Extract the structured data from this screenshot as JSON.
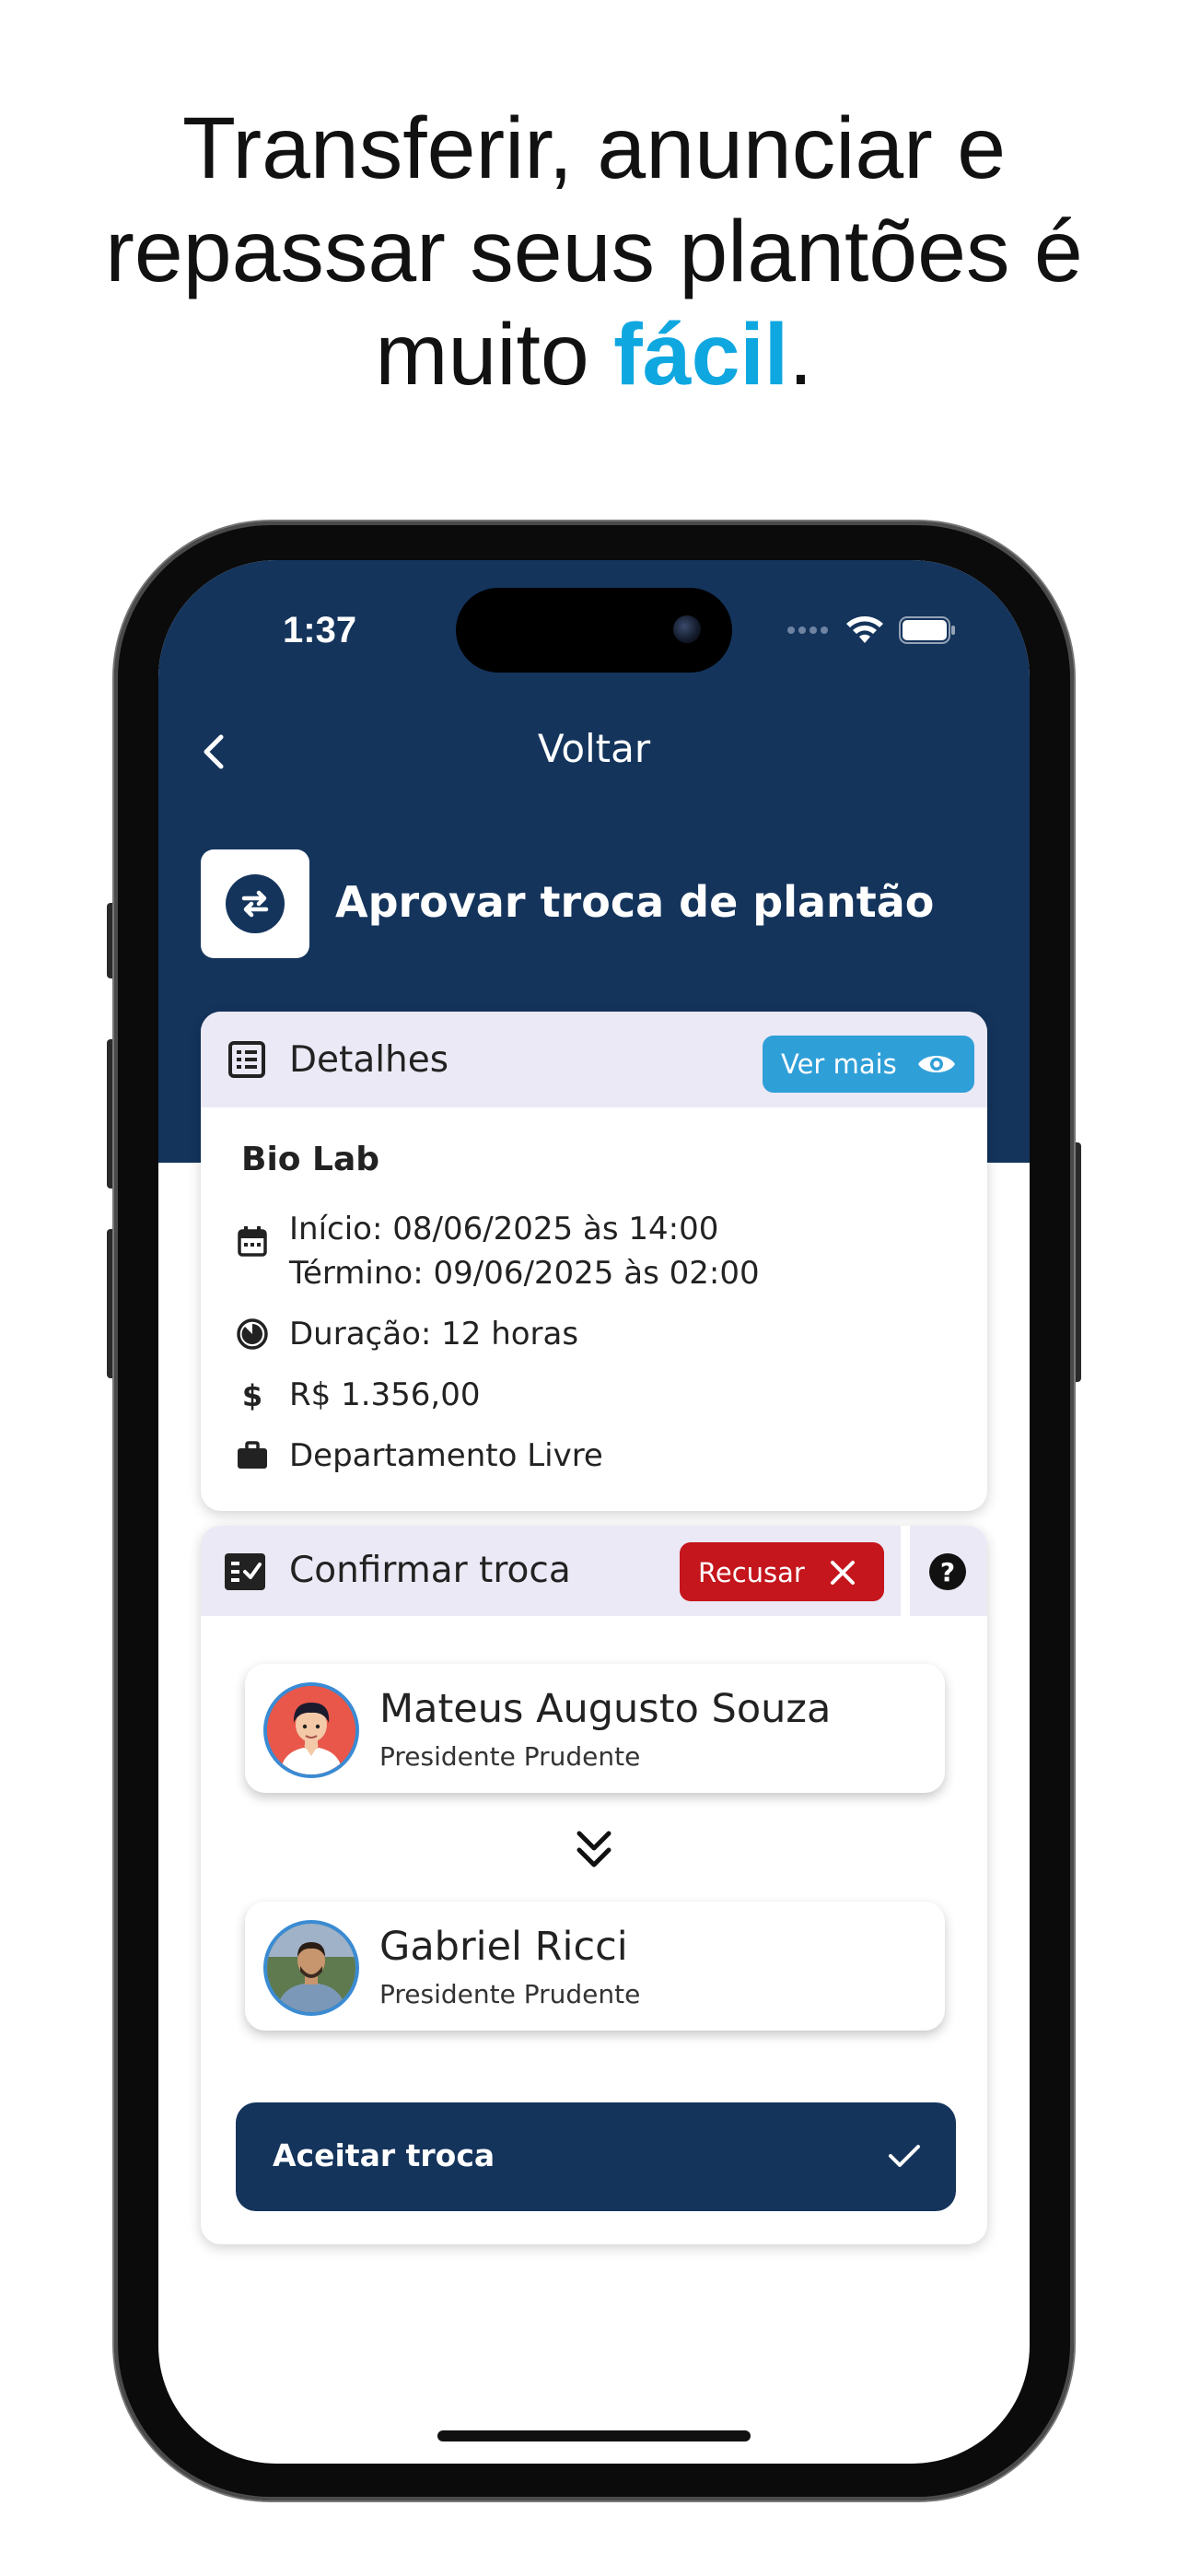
{
  "headline": {
    "line1": "Transferir, anunciar e",
    "line2": "repassar seus plantões é",
    "line3_prefix": "muito ",
    "line3_accent": "fácil",
    "line3_suffix": "."
  },
  "status_bar": {
    "time": "1:37"
  },
  "header": {
    "back_label": "Voltar",
    "page_title": "Aprovar troca de plantão"
  },
  "details_card": {
    "header_label": "Detalhes",
    "see_more_label": "Ver mais",
    "place_name": "Bio Lab",
    "start": "Início: 08/06/2025 às 14:00",
    "end": "Término: 09/06/2025 às 02:00",
    "duration": "Duração: 12 horas",
    "price": "R$ 1.356,00",
    "department": "Departamento Livre"
  },
  "confirm_card": {
    "header_label": "Confirmar troca",
    "decline_label": "Recusar",
    "from_person": {
      "name": "Mateus Augusto Souza",
      "city": "Presidente Prudente"
    },
    "to_person": {
      "name": "Gabriel Ricci",
      "city": "Presidente Prudente"
    },
    "accept_label": "Aceitar troca"
  },
  "colors": {
    "navy": "#14345c",
    "accent_blue": "#0fa7e0",
    "see_more_blue": "#2f9fd8",
    "decline_red": "#c4161c",
    "card_header_bg": "#ebe9f5"
  }
}
